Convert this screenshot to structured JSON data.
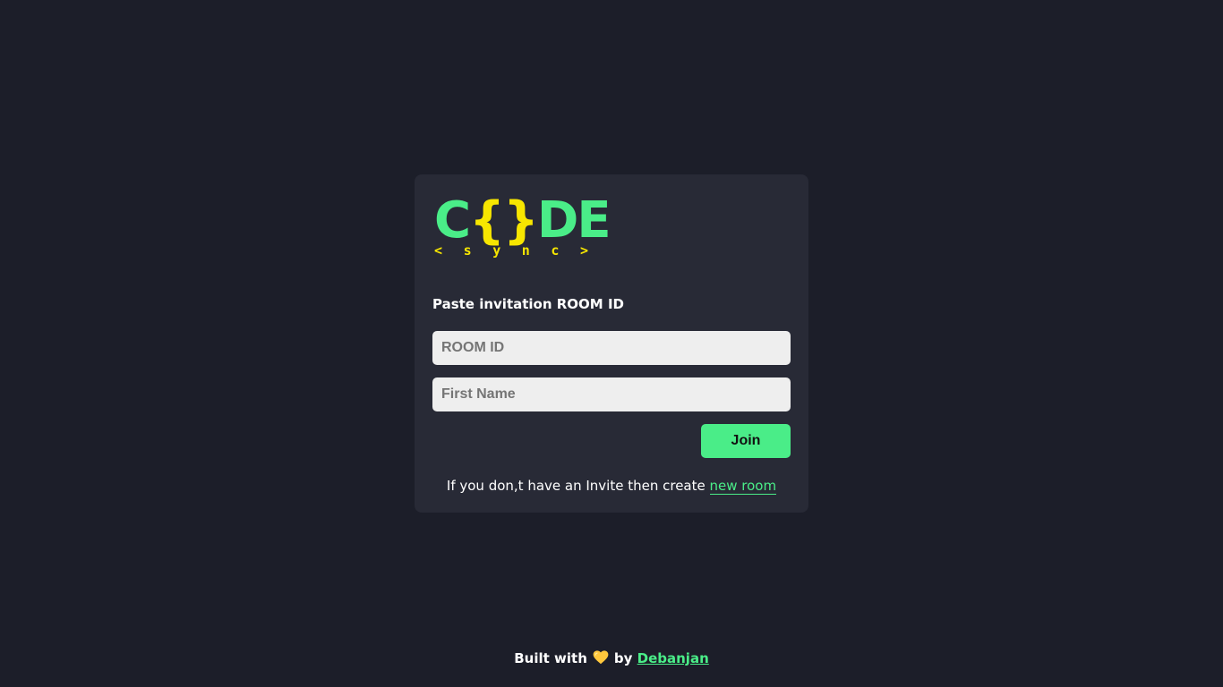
{
  "logo": {
    "c": "C",
    "braces": "{}",
    "de": "DE",
    "sub_letters": [
      "<",
      "s",
      "y",
      "n",
      "c",
      ">"
    ]
  },
  "form": {
    "heading": "Paste invitation ROOM ID",
    "room_id_placeholder": "ROOM ID",
    "room_id_value": "",
    "name_placeholder": "First Name",
    "name_value": "",
    "join_label": "Join"
  },
  "create": {
    "text": "If you don,t have an Invite then create ",
    "link_label": "new room"
  },
  "footer": {
    "built_with": "Built with",
    "heart_icon": "yellow-heart-icon",
    "by": "by",
    "author": "Debanjan"
  },
  "colors": {
    "background": "#1c1e29",
    "card": "#282a36",
    "accent_green": "#4aed88",
    "accent_yellow": "#f7e600",
    "input_bg": "#eeeeee",
    "heart": "#ffc83d"
  }
}
